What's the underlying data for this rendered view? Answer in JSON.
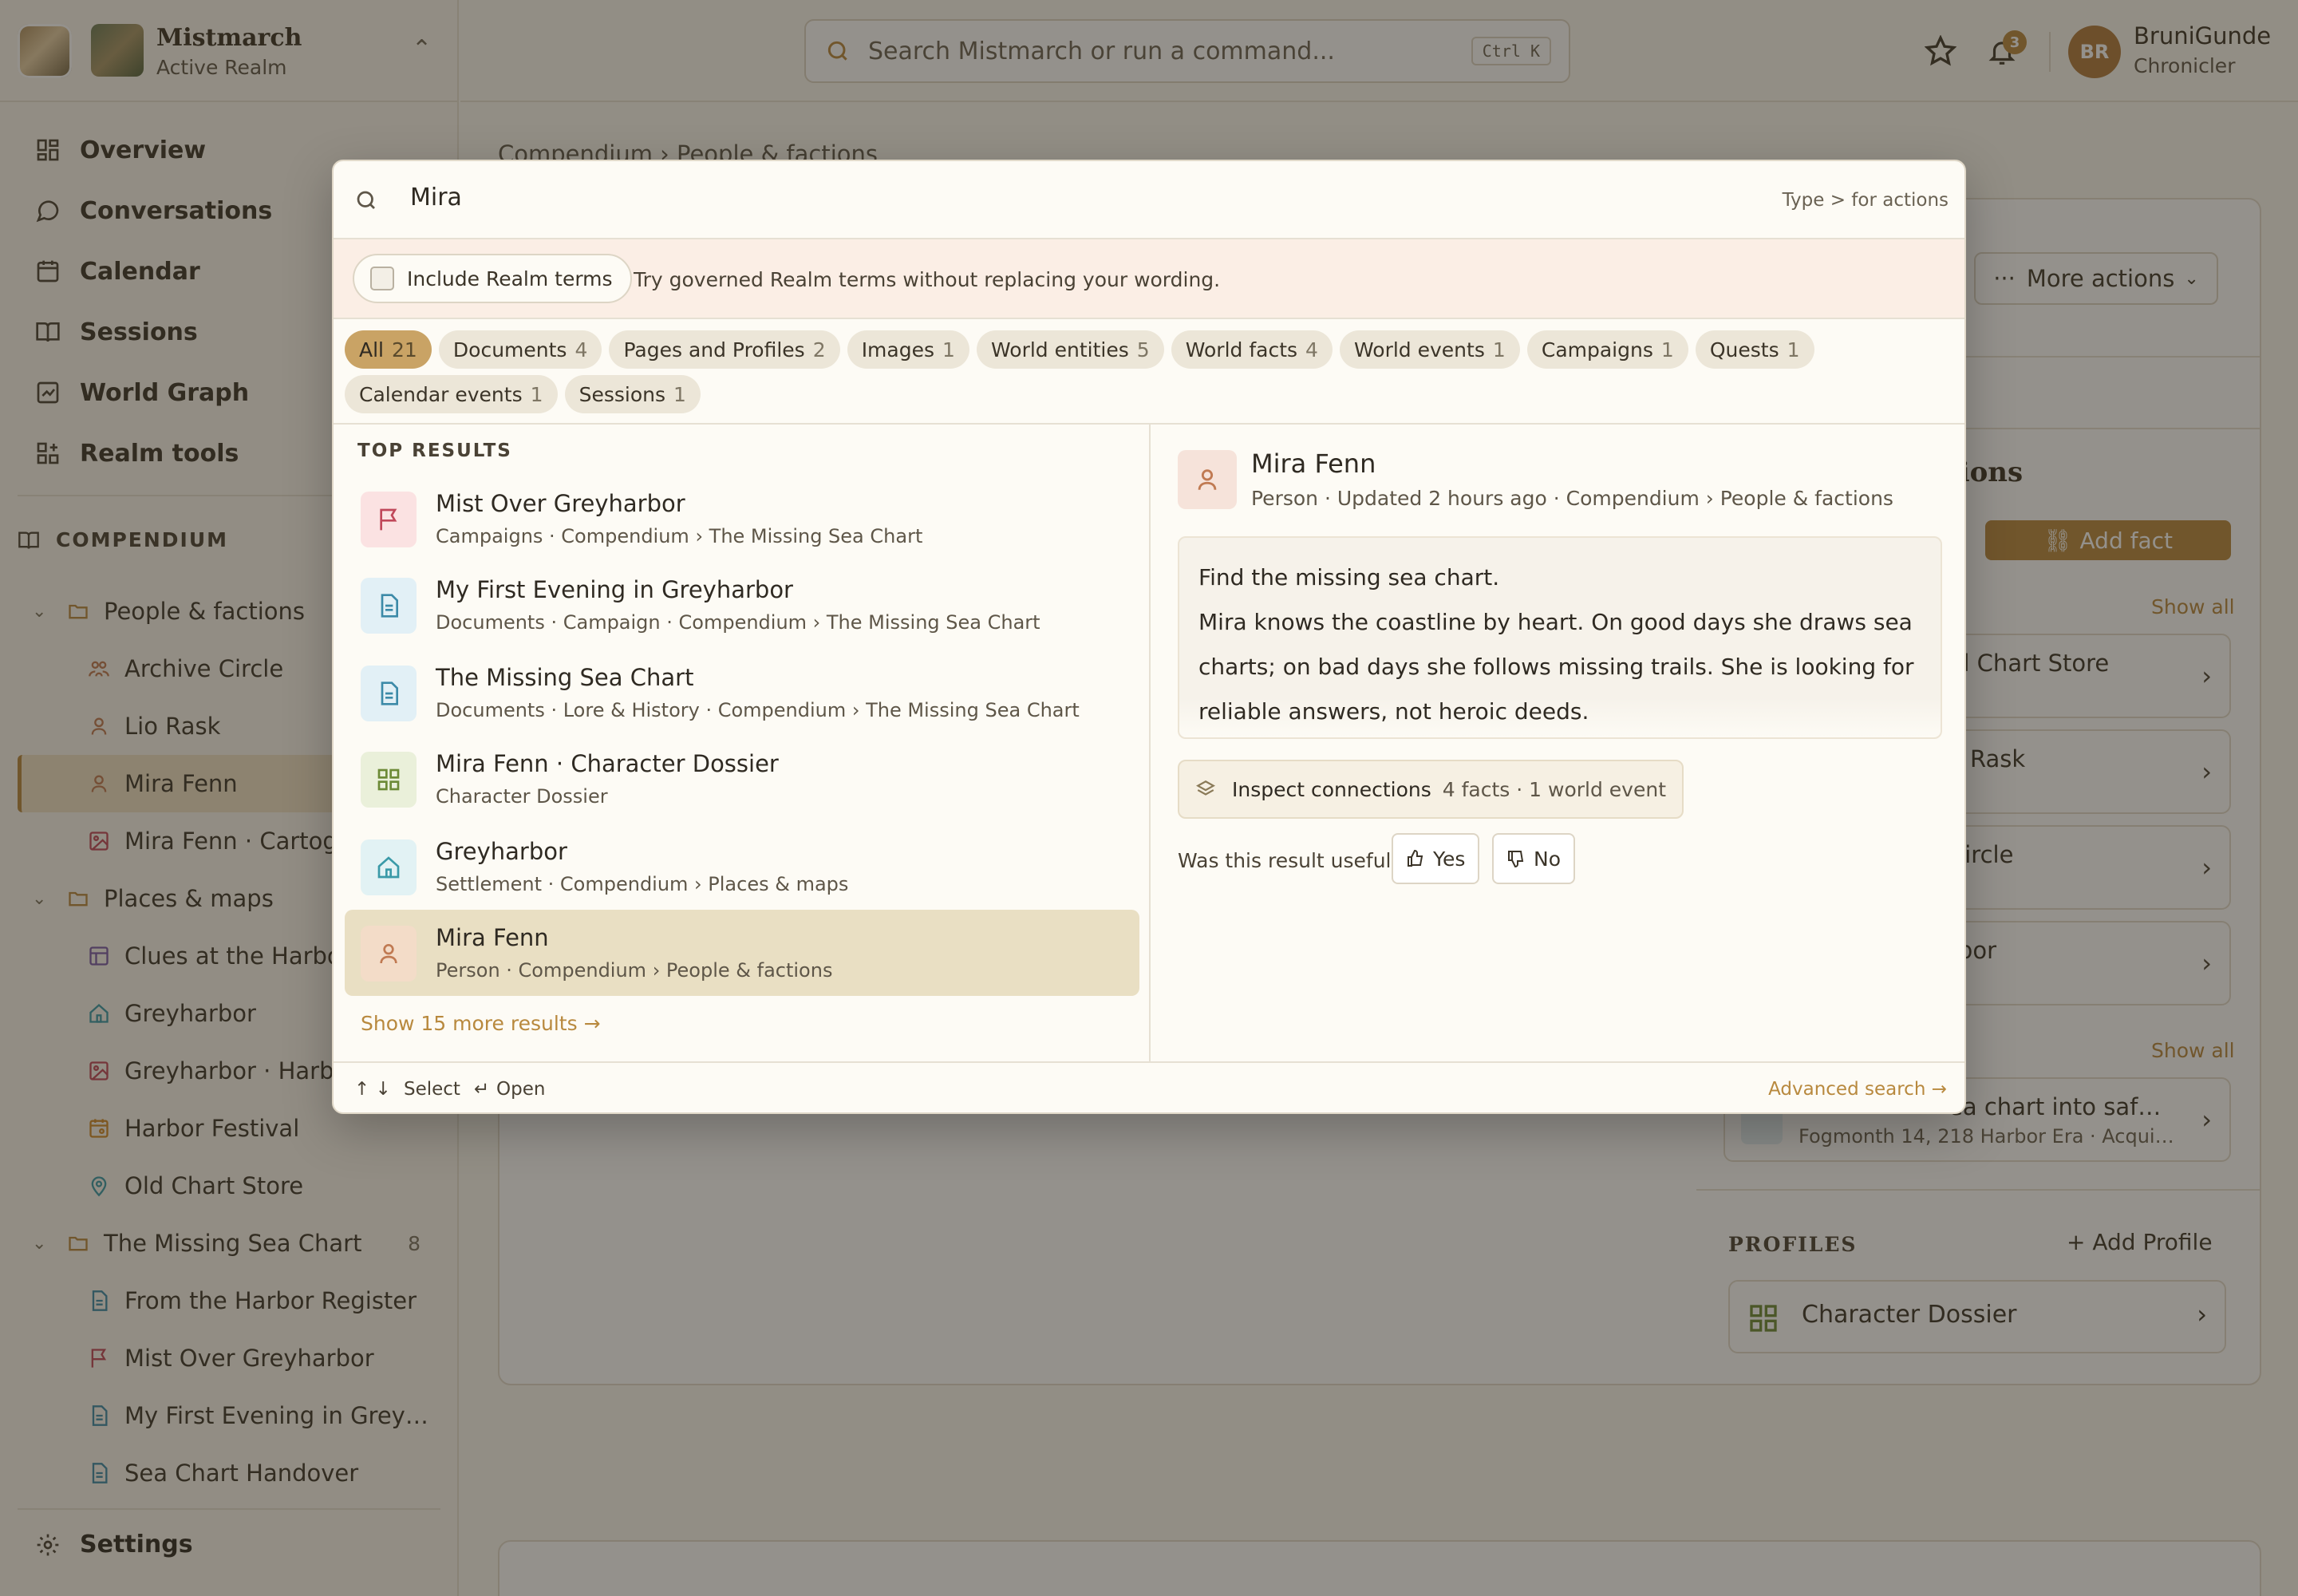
{
  "realm": {
    "name": "Mistmarch",
    "subtitle": "Active Realm"
  },
  "nav": [
    {
      "label": "Overview",
      "icon": "overview-icon"
    },
    {
      "label": "Conversations",
      "icon": "chat-icon"
    },
    {
      "label": "Calendar",
      "icon": "calendar-icon"
    },
    {
      "label": "Sessions",
      "icon": "book-icon"
    },
    {
      "label": "World Graph",
      "icon": "graph-icon"
    },
    {
      "label": "Realm tools",
      "icon": "tools-icon"
    }
  ],
  "compendium": {
    "heading": "COMPENDIUM",
    "tree": [
      {
        "label": "People & factions",
        "type": "folder"
      },
      {
        "label": "Archive Circle",
        "type": "group"
      },
      {
        "label": "Lio Rask",
        "type": "person"
      },
      {
        "label": "Mira Fenn",
        "type": "person",
        "selected": true
      },
      {
        "label": "Mira Fenn · Cartography",
        "type": "image"
      },
      {
        "label": "Places & maps",
        "type": "folder"
      },
      {
        "label": "Clues at the Harbor",
        "type": "board"
      },
      {
        "label": "Greyharbor",
        "type": "settlement"
      },
      {
        "label": "Greyharbor · Harbor",
        "type": "image"
      },
      {
        "label": "Harbor Festival",
        "type": "event"
      },
      {
        "label": "Old Chart Store",
        "type": "location"
      },
      {
        "label": "The Missing Sea Chart",
        "type": "folder",
        "count": "8"
      },
      {
        "label": "From the Harbor Register",
        "type": "document"
      },
      {
        "label": "Mist Over Greyharbor",
        "type": "campaign"
      },
      {
        "label": "My First Evening in Grey…",
        "type": "document"
      },
      {
        "label": "Sea Chart Handover",
        "type": "document"
      }
    ]
  },
  "settings_label": "Settings",
  "topbar": {
    "search_placeholder": "Search Mistmarch or run a command...",
    "shortcut": "Ctrl K",
    "notification_count": "3",
    "user_initials": "BR",
    "user_name": "BruniGunde",
    "user_role": "Chronicler"
  },
  "background": {
    "breadcrumb": "Compendium › People & factions",
    "more_actions": "More actions",
    "section_title": "tions",
    "add_fact": "Add fact",
    "show_all": "Show all",
    "linked": [
      {
        "title": "ld Chart Store",
        "sub": ""
      },
      {
        "title": "o Rask",
        "sub": ""
      },
      {
        "title": "Circle",
        "sub": ""
      },
      {
        "title": "rbor",
        "sub": ""
      }
    ],
    "event": {
      "title": "ea chart into saf…",
      "sub": "Fogmonth 14, 218 Harbor Era · Acqui…"
    },
    "profiles_heading": "PROFILES",
    "add_profile": "Add Profile",
    "profile_card": "Character Dossier"
  },
  "palette": {
    "query": "Mira",
    "hint": "Type > for actions",
    "include_terms": "Include Realm terms",
    "terms_hint": "Try governed Realm terms without replacing your wording.",
    "filters": [
      {
        "label": "All",
        "count": "21",
        "active": true
      },
      {
        "label": "Documents",
        "count": "4"
      },
      {
        "label": "Pages and Profiles",
        "count": "2"
      },
      {
        "label": "Images",
        "count": "1"
      },
      {
        "label": "World entities",
        "count": "5"
      },
      {
        "label": "World facts",
        "count": "4"
      },
      {
        "label": "World events",
        "count": "1"
      },
      {
        "label": "Campaigns",
        "count": "1"
      },
      {
        "label": "Quests",
        "count": "1"
      },
      {
        "label": "Calendar events",
        "count": "1"
      },
      {
        "label": "Sessions",
        "count": "1"
      }
    ],
    "top_results_heading": "TOP RESULTS",
    "results": [
      {
        "title": "Mist Over Greyharbor",
        "sub": "Campaigns · Compendium › The Missing Sea Chart",
        "icon": "flag-icon",
        "tint": "#fbe2e2",
        "color": "#c0485a"
      },
      {
        "title": "My First Evening in Greyharbor",
        "sub": "Documents · Campaign · Compendium › The Missing Sea Chart",
        "icon": "document-icon",
        "tint": "#e2f0f6",
        "color": "#3c8aa8"
      },
      {
        "title": "The Missing Sea Chart",
        "sub": "Documents · Lore & History · Compendium › The Missing Sea Chart",
        "icon": "document-icon",
        "tint": "#e2f0f6",
        "color": "#3c8aa8"
      },
      {
        "title": "Mira Fenn · Character Dossier",
        "sub": "Character Dossier",
        "icon": "profile-grid-icon",
        "tint": "#eaf0da",
        "color": "#6c8a36"
      },
      {
        "title": "Greyharbor",
        "sub": "Settlement · Compendium › Places & maps",
        "icon": "home-icon",
        "tint": "#e2f2f4",
        "color": "#3a9aa8"
      },
      {
        "title": "Mira Fenn",
        "sub": "Person · Compendium › People & factions",
        "icon": "person-icon",
        "tint": "#f3dcc8",
        "color": "#c07a52",
        "selected": true
      }
    ],
    "show_more": "Show 15 more results",
    "preview": {
      "name": "Mira Fenn",
      "meta": "Person · Updated 2 hours ago · Compendium › People & factions",
      "summary": "Find the missing sea chart.",
      "body": "Mira knows the coastline by heart. On good days she draws sea charts; on bad days she follows missing trails. She is looking for reliable answers, not heroic deeds.",
      "inspect_label": "Inspect connections",
      "inspect_meta": "4 facts · 1 world event",
      "useful_question": "Was this result useful?",
      "yes": "Yes",
      "no": "No"
    },
    "footer": {
      "select": "Select",
      "open": "Open",
      "advanced": "Advanced search"
    }
  }
}
